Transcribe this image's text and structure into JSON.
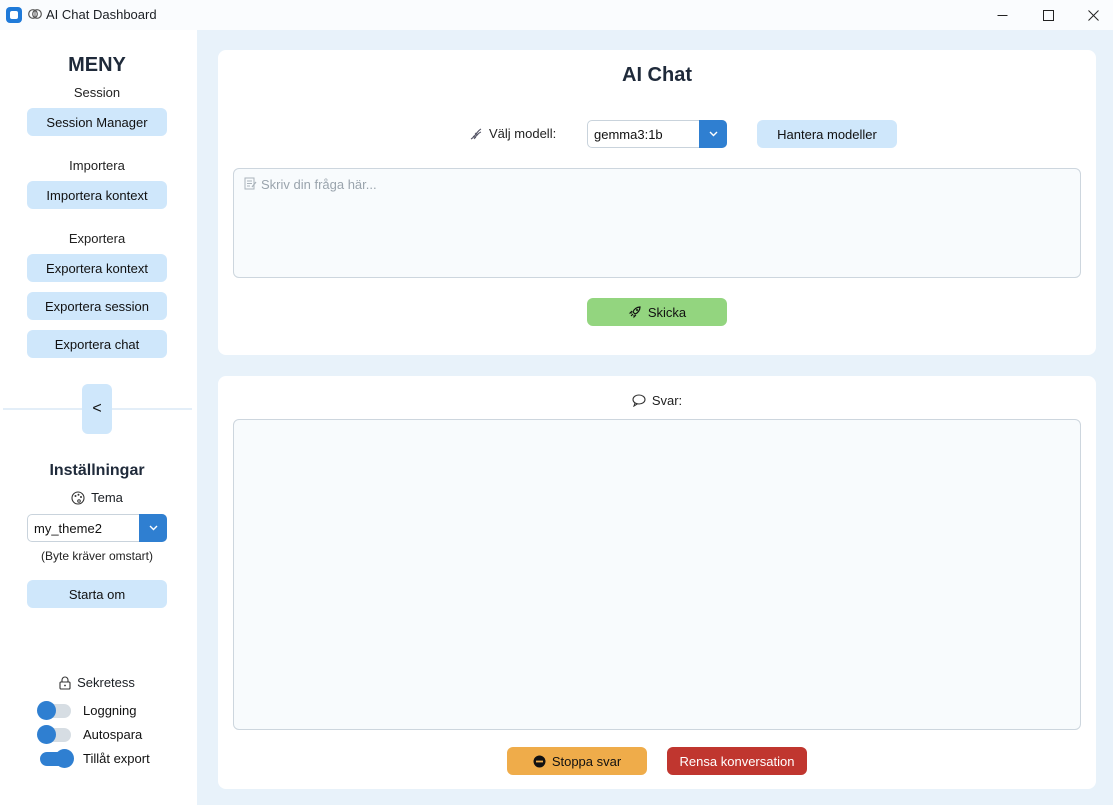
{
  "window": {
    "title": "AI Chat Dashboard"
  },
  "sidebar": {
    "menu_title": "MENY",
    "sections": [
      {
        "label": "Session",
        "buttons": [
          "Session Manager"
        ]
      },
      {
        "label": "Importera",
        "buttons": [
          "Importera kontext"
        ]
      },
      {
        "label": "Exportera",
        "buttons": [
          "Exportera kontext",
          "Exportera session",
          "Exportera chat"
        ]
      }
    ],
    "collapse_label": "<",
    "settings": {
      "title": "Inställningar",
      "theme_label": "Tema",
      "theme_value": "my_theme2",
      "theme_note": "(Byte kräver omstart)",
      "restart_label": "Starta om"
    },
    "privacy": {
      "title": "Sekretess",
      "toggles": [
        {
          "label": "Loggning",
          "on": false
        },
        {
          "label": "Autospara",
          "on": false
        },
        {
          "label": "Tillåt export",
          "on": true
        }
      ]
    }
  },
  "chat": {
    "title": "AI Chat",
    "model_label": "Välj modell:",
    "model_value": "gemma3:1b",
    "manage_models_label": "Hantera modeller",
    "input_placeholder": "Skriv din fråga här...",
    "send_label": "Skicka",
    "answer_label": "Svar:",
    "answer_text": "",
    "stop_label": "Stoppa svar",
    "clear_label": "Rensa konversation"
  },
  "colors": {
    "accent": "#2f7fd1",
    "button_bg": "#cfe7fb",
    "send_bg": "#93d57f",
    "stop_bg": "#efac4a",
    "clear_bg": "#c0362f",
    "main_bg": "#e8f2fa"
  }
}
